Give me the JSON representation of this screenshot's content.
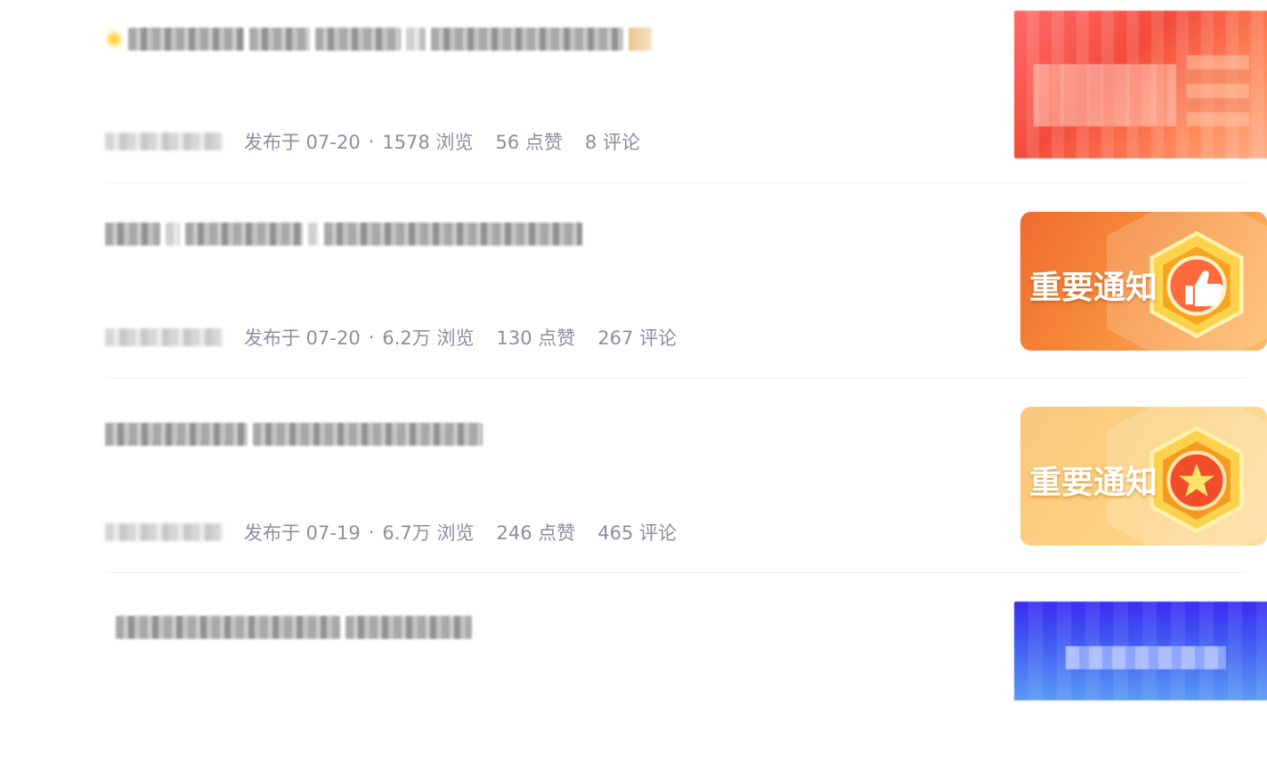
{
  "posts": [
    {
      "meta": {
        "published": "发布于 07-20",
        "sep": "·",
        "views": "1578 浏览",
        "likes": "56 点赞",
        "comments": "8 评论"
      }
    },
    {
      "meta": {
        "published": "发布于 07-20",
        "sep": "·",
        "views": "6.2万 浏览",
        "likes": "130 点赞",
        "comments": "267 评论"
      },
      "thumb_text": "重要通知",
      "badge_icon": "thumbs-up-icon"
    },
    {
      "meta": {
        "published": "发布于 07-19",
        "sep": "·",
        "views": "6.7万 浏览",
        "likes": "246 点赞",
        "comments": "465 评论"
      },
      "thumb_text": "重要通知",
      "badge_icon": "star-icon"
    },
    {
      "meta": {}
    }
  ],
  "colors": {
    "meta_text": "#8a8f99",
    "divider": "#eef0f3",
    "orange_thumb": "#f58d3b",
    "yellow_thumb": "#fcd27f",
    "red_thumb": "#f44b3a",
    "blue_thumb": "#3f59f4"
  }
}
